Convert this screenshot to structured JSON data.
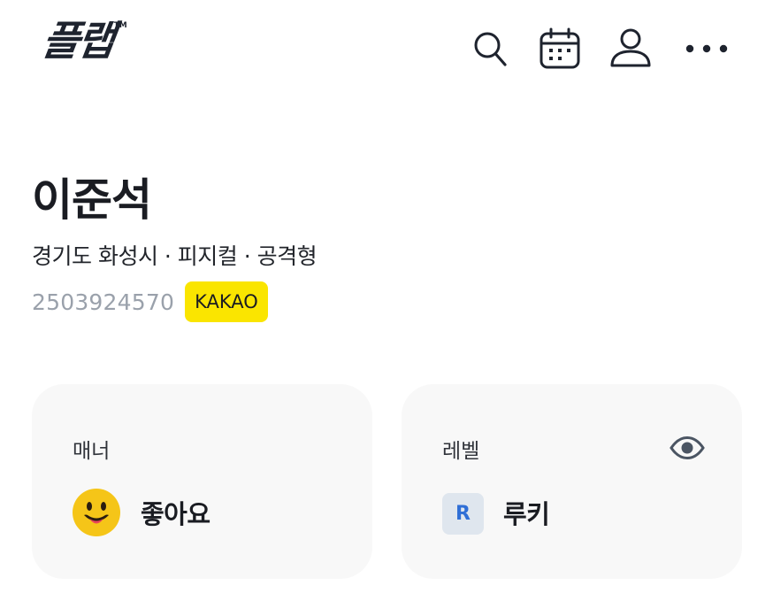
{
  "header": {
    "logo_text": "플랩",
    "logo_tm": "TM",
    "icons": [
      "search-icon",
      "calendar-icon",
      "profile-icon",
      "more-icon"
    ]
  },
  "profile": {
    "name": "이준석",
    "details": "경기도 화성시 · 피지컬 · 공격형",
    "user_id": "2503924570",
    "badge": "KAKAO"
  },
  "cards": {
    "manner": {
      "title": "매너",
      "value": "좋아요",
      "icon": "smiley-face-icon"
    },
    "level": {
      "title": "레벨",
      "value": "루키",
      "level_letter": "R",
      "icon": "eye-icon"
    }
  },
  "colors": {
    "text": "#1a1c22",
    "muted": "#9aa1ab",
    "kakao_yellow": "#fae500",
    "card_bg": "#f8f8f8",
    "level_blue": "#2f6fd6",
    "smiley_yellow": "#f5c518"
  }
}
